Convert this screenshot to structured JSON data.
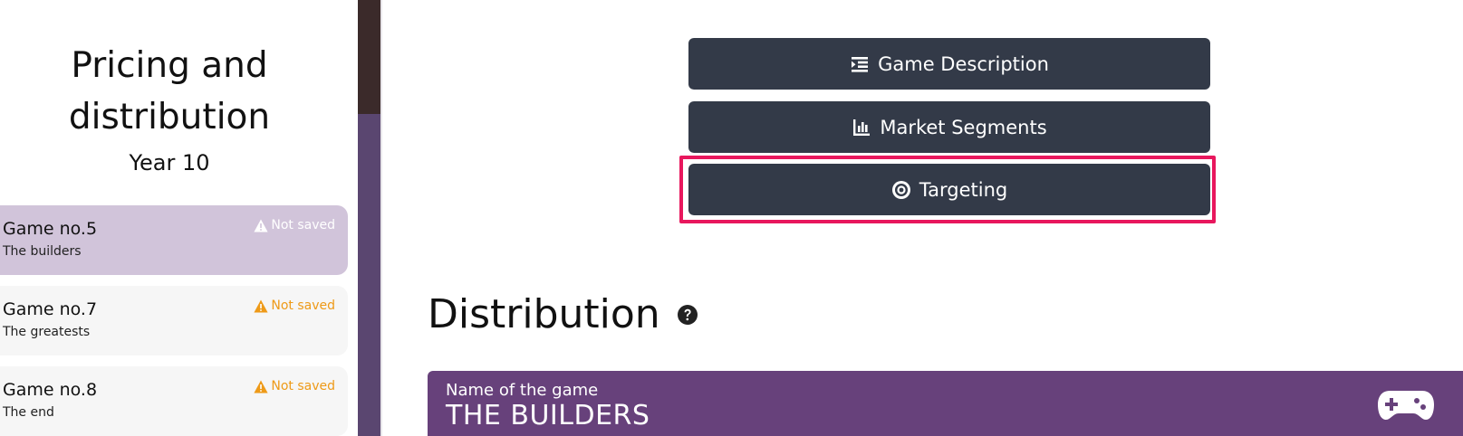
{
  "sidebar": {
    "title": "Pricing and distribution",
    "year": "Year 10",
    "games": [
      {
        "name": "Game no.5",
        "subtitle": "The builders",
        "status": "Not saved",
        "active": true
      },
      {
        "name": "Game no.7",
        "subtitle": "The greatests",
        "status": "Not saved",
        "active": false
      },
      {
        "name": "Game no.8",
        "subtitle": "The end",
        "status": "Not saved",
        "active": false
      }
    ]
  },
  "nav": {
    "game_description": "Game Description",
    "market_segments": "Market Segments",
    "targeting": "Targeting"
  },
  "distribution": {
    "title": "Distribution",
    "name_label": "Name of the game",
    "name_value": "THE BUILDERS"
  },
  "icons": {
    "game_description": "indent-list-icon",
    "market_segments": "bar-chart-icon",
    "targeting": "target-icon",
    "help": "question-circle-icon",
    "warning": "warning-triangle-icon",
    "gamepad": "gamepad-icon"
  },
  "colors": {
    "button_bg": "#333a48",
    "highlight": "#e8175d",
    "card_purple": "#67417b",
    "active_game_bg": "#d1c4da",
    "warning_orange": "#ee9a18"
  }
}
